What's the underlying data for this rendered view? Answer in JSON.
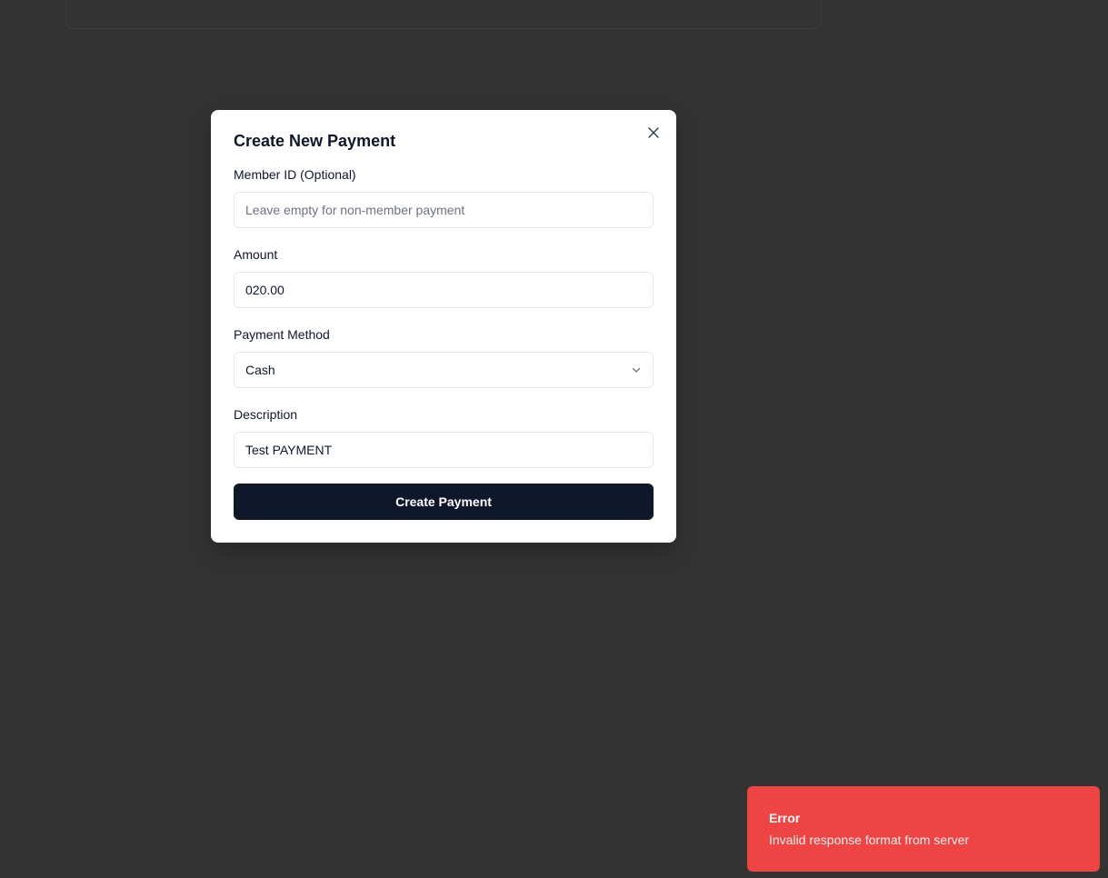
{
  "modal": {
    "title": "Create New Payment",
    "close_icon": "close-icon",
    "fields": {
      "member_id": {
        "label": "Member ID (Optional)",
        "value": "",
        "placeholder": "Leave empty for non-member payment"
      },
      "amount": {
        "label": "Amount",
        "value": "020.00"
      },
      "payment_method": {
        "label": "Payment Method",
        "selected": "Cash",
        "icon": "chevron-down-icon"
      },
      "description": {
        "label": "Description",
        "value": "Test PAYMENT"
      }
    },
    "submit_label": "Create Payment"
  },
  "toast": {
    "title": "Error",
    "message": "Invalid response format from server",
    "color": "#ef4444"
  },
  "colors": {
    "backdrop": "#333333",
    "primary_button": "#0f172a"
  }
}
